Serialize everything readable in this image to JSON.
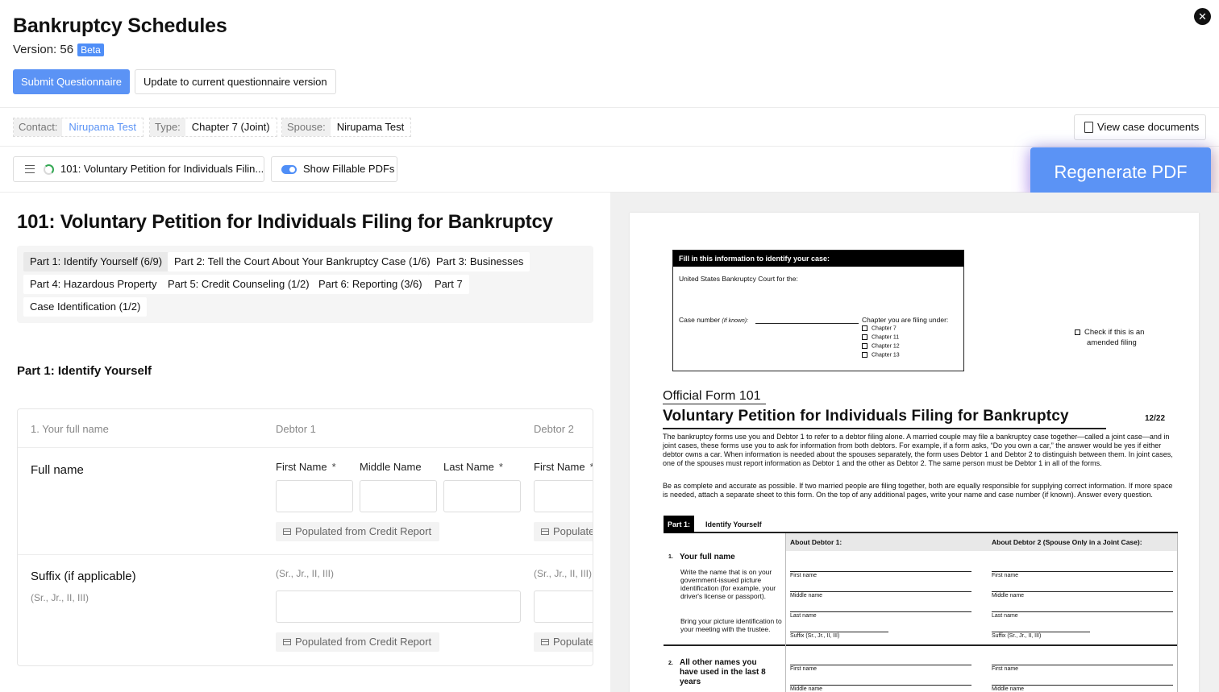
{
  "header": {
    "title": "Bankruptcy Schedules",
    "version_label": "Version: 56",
    "beta_label": "Beta",
    "close_icon": "close-icon",
    "submit_label": "Submit Questionnaire",
    "update_label": "Update to current questionnaire version"
  },
  "meta": {
    "contact_key": "Contact:",
    "contact_value": "Nirupama Test",
    "type_key": "Type:",
    "type_value": "Chapter 7 (Joint)",
    "spouse_key": "Spouse:",
    "spouse_value": "Nirupama Test",
    "view_docs_label": "View case documents"
  },
  "toolbar": {
    "form_select_label": "101: Voluntary Petition for Individuals Filin...",
    "show_fillable_label": "Show Fillable PDFs",
    "regenerate_label": "Regenerate PDF"
  },
  "form": {
    "title": "101: Voluntary Petition for Individuals Filing for Bankruptcy",
    "parts": [
      "Part 1: Identify Yourself (6/9)",
      "Part 2: Tell the Court About Your Bankruptcy Case (1/6)",
      "Part 3: Businesses",
      "Part 4: Hazardous Property",
      "Part 5: Credit Counseling (1/2)",
      "Part 6: Reporting (3/6)",
      "Part 7",
      "Case Identification (1/2)"
    ],
    "section_title": "Part 1: Identify Yourself",
    "card": {
      "question": "1. Your full name",
      "debtor1": "Debtor 1",
      "debtor2": "Debtor 2",
      "full_name_label": "Full name",
      "first_name": "First Name",
      "middle_name": "Middle Name",
      "last_name": "Last Name",
      "required_mark": "*",
      "populated_label": "Populated from Credit Report",
      "populated_clipped": "Populate",
      "suffix_label": "Suffix (if applicable)",
      "suffix_hint": "(Sr., Jr., II, III)"
    }
  },
  "pdf": {
    "box_head": "Fill in this information to identify your case:",
    "court_label": "United States Bankruptcy Court for the:",
    "case_number_label": "Case number",
    "if_known": "(If known):",
    "chapter_label": "Chapter you are filing under:",
    "chapters": [
      "Chapter 7",
      "Chapter 11",
      "Chapter 12",
      "Chapter 13"
    ],
    "amended_line1": "Check if this is an",
    "amended_line2": "amended filing",
    "form_number": "Official Form 101",
    "form_title": "Voluntary Petition for Individuals Filing for Bankruptcy",
    "form_date": "12/22",
    "para1": "The bankruptcy forms use you and Debtor 1 to refer to a debtor filing alone. A married couple may file a bankruptcy case together—called a joint case—and in joint cases, these forms use you to ask for information from both debtors. For example, if a form asks, “Do you own a car,” the answer would be yes if either debtor owns a car. When information is needed about the spouses separately, the form uses Debtor 1 and Debtor 2 to distinguish between them. In joint cases, one of the spouses must report information as Debtor 1 and the other as Debtor 2. The same person must be Debtor 1 in all of the forms.",
    "para2": "Be as complete and accurate as possible. If two married people are filing together, both are equally responsible for supplying correct information. If more space is needed, attach a separate sheet to this form. On the top of any additional pages, write your name and case number (if known). Answer every question.",
    "part_tag": "Part 1:",
    "part_name": "Identify Yourself",
    "about_debtor1": "About Debtor 1:",
    "about_debtor2": "About Debtor 2 (Spouse Only in a Joint Case):",
    "q1_num": "1.",
    "q1_title": "Your full name",
    "q1_desc1": "Write the name that is on your government-issued picture identification (for example, your driver's license or passport).",
    "q1_desc2": "Bring your picture identification to your meeting with the trustee.",
    "first_name": "First name",
    "middle_name": "Middle name",
    "last_name": "Last name",
    "suffix": "Suffix (Sr., Jr., II, III)",
    "q2_num": "2.",
    "q2_title": "All other names you have used in the last 8 years"
  }
}
